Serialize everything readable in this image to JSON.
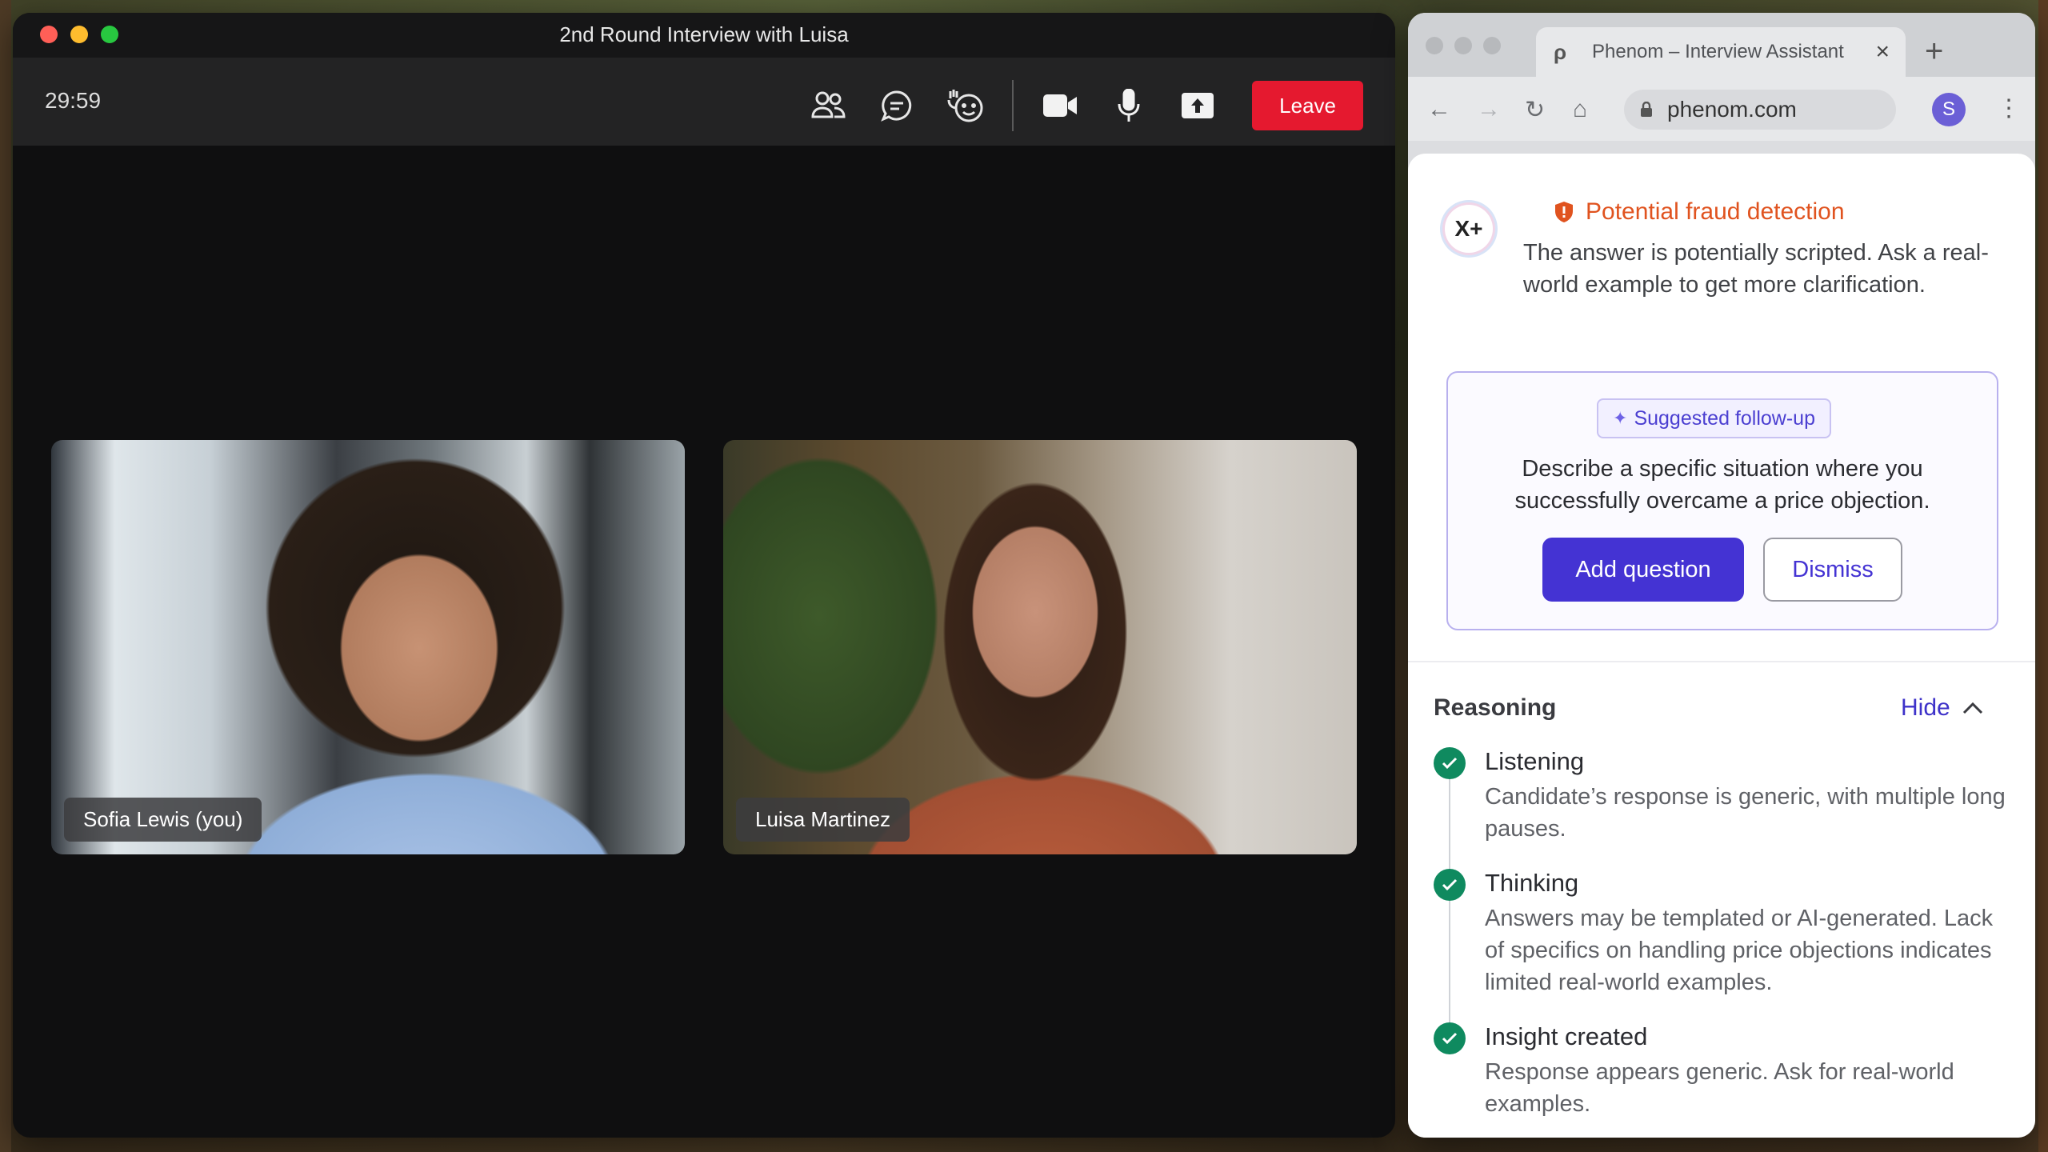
{
  "meeting": {
    "title": "2nd Round Interview with Luisa",
    "timer": "29:59",
    "leave_label": "Leave",
    "toolbar_icons": [
      "participants-icon",
      "chat-icon",
      "reactions-icon",
      "camera-icon",
      "microphone-icon",
      "share-screen-icon"
    ],
    "participants": [
      {
        "name": "Sofia Lewis (you)"
      },
      {
        "name": "Luisa Martinez"
      }
    ]
  },
  "browser": {
    "tab_title": "Phenom – Interview Assistant",
    "url": "phenom.com",
    "avatar_initial": "S"
  },
  "assistant": {
    "logo_text": "X+",
    "alert_title": "Potential fraud detection",
    "alert_desc": "The answer is potentially scripted. Ask a real-world example to get more clarification.",
    "suggest_label": "Suggested follow-up",
    "suggest_text": "Describe a specific situation where you successfully overcame a price objection.",
    "add_label": "Add question",
    "dismiss_label": "Dismiss",
    "reasoning_title": "Reasoning",
    "hide_label": "Hide",
    "steps": [
      {
        "title": "Listening",
        "desc": "Candidate’s response is generic, with multiple long pauses."
      },
      {
        "title": "Thinking",
        "desc": "Answers may be templated or AI-generated. Lack of specifics on handling price objections indicates limited real-world examples."
      },
      {
        "title": "Insight created",
        "desc": "Response appears generic. Ask for real-world examples."
      }
    ]
  },
  "colors": {
    "leave": "#e5192f",
    "accent": "#4433d3",
    "alert": "#e0531f",
    "success": "#0f8a5f"
  }
}
